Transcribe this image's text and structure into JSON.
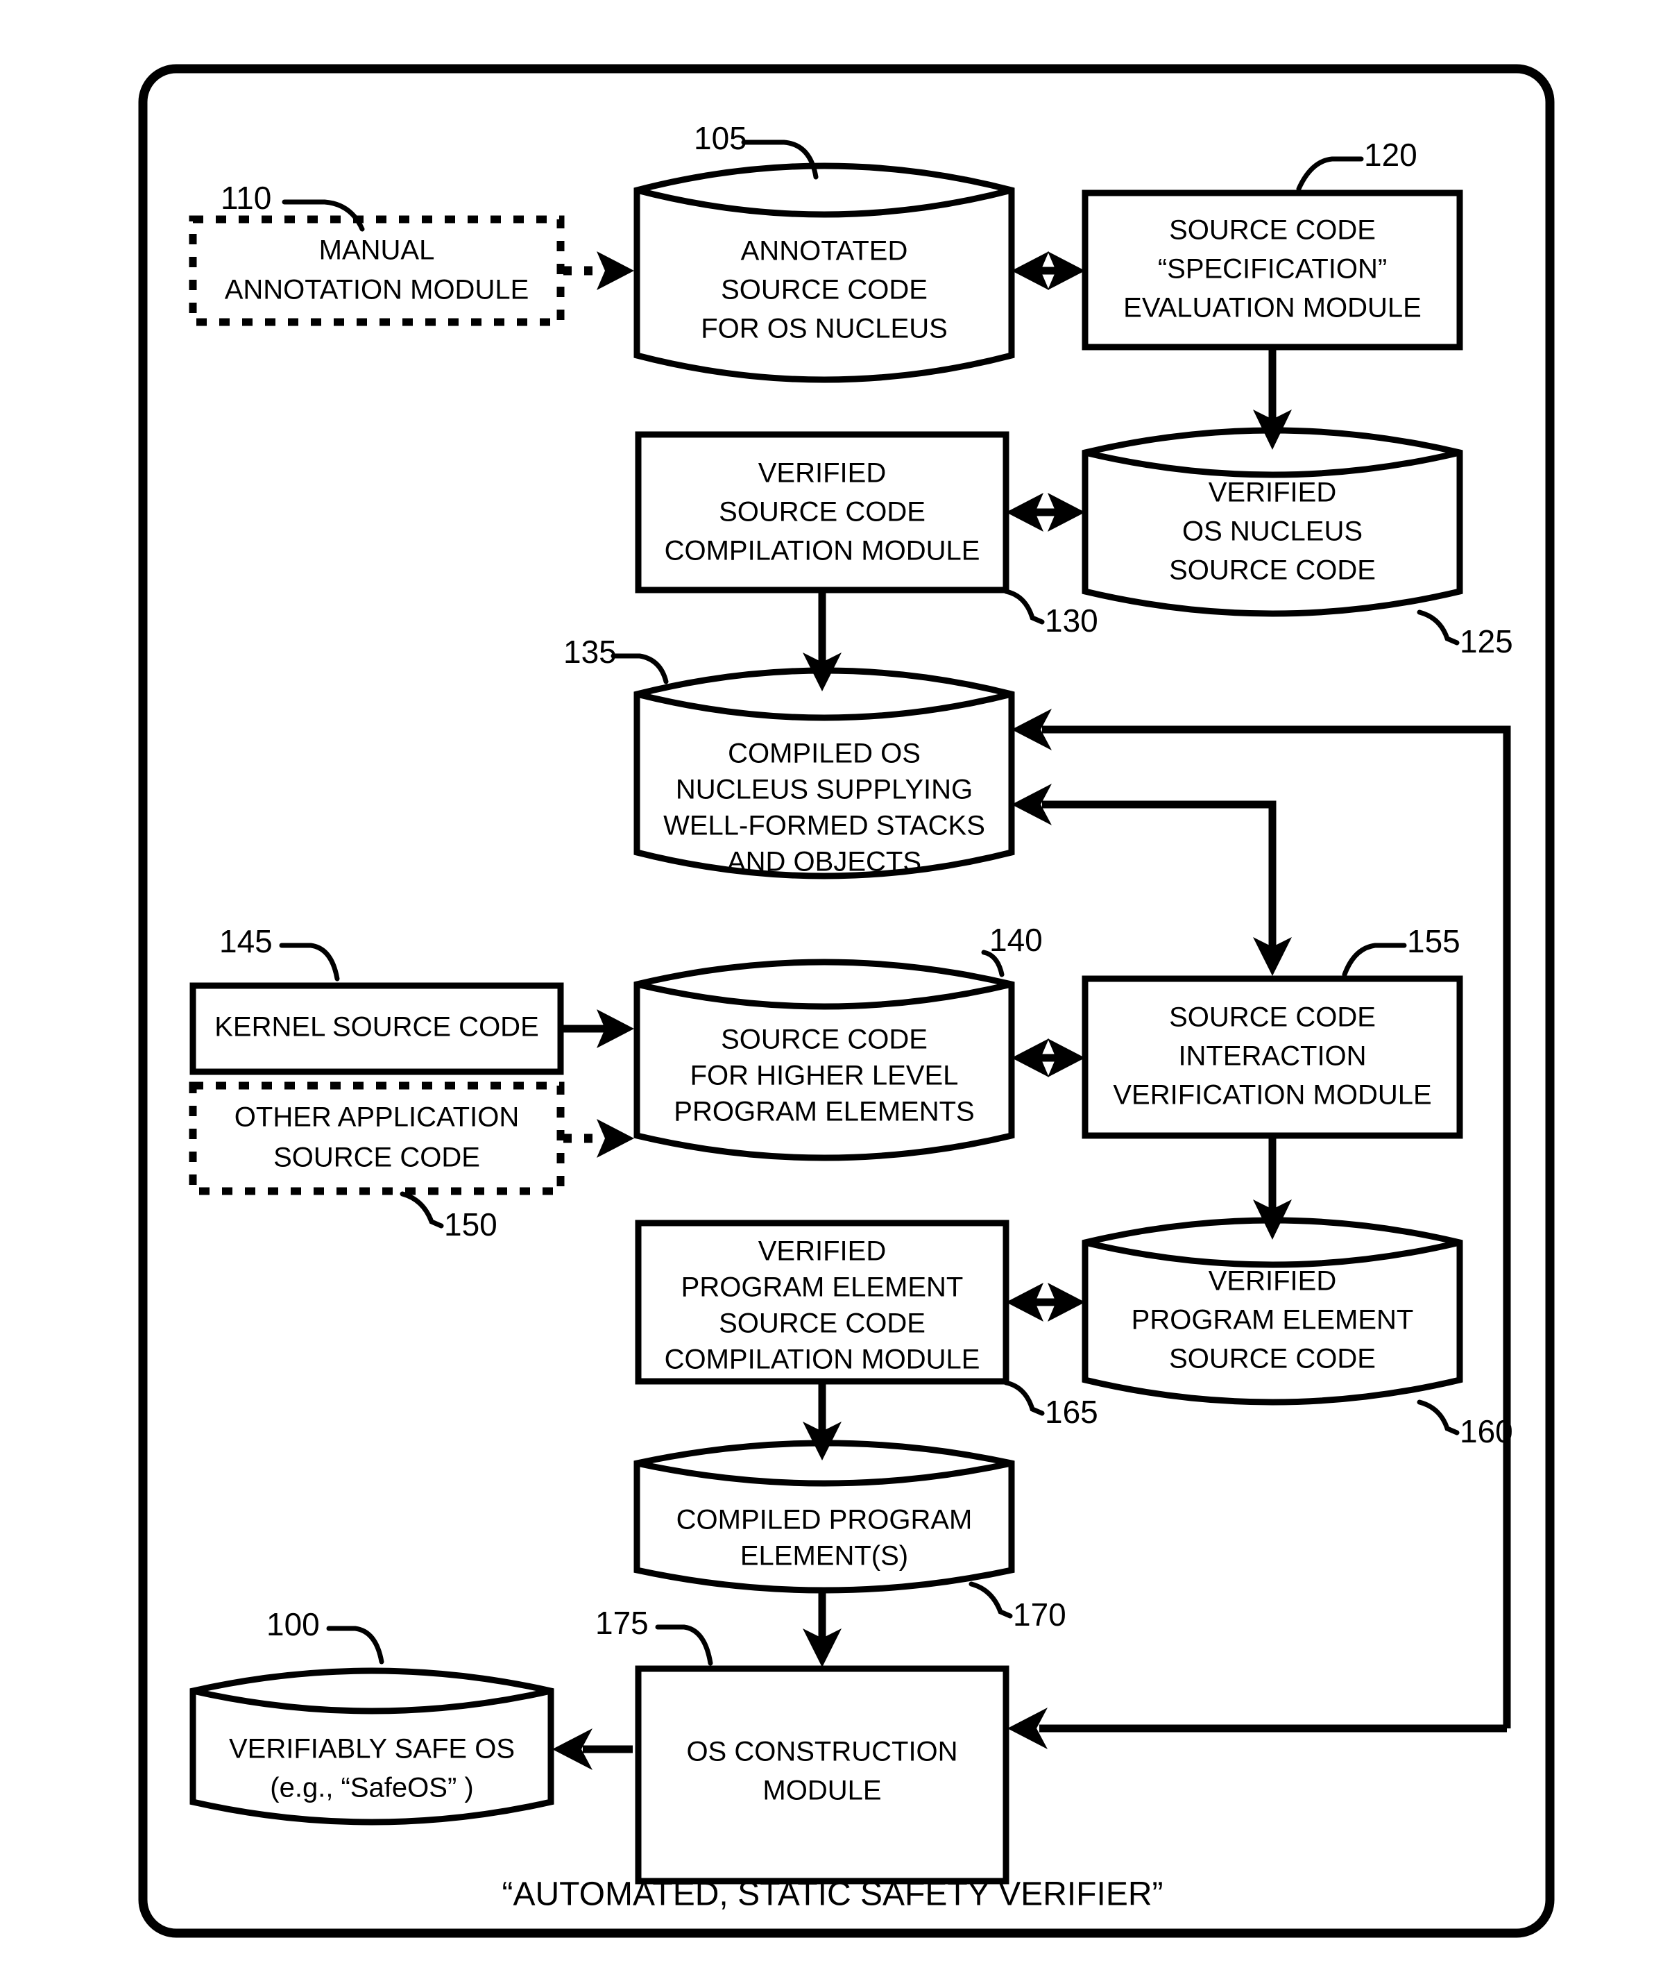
{
  "figure": {
    "caption": "“AUTOMATED, STATIC SAFETY VERIFIER”"
  },
  "nodes": {
    "manual_annotation_module": {
      "ref": "110",
      "lines": [
        "MANUAL",
        "ANNOTATION MODULE"
      ],
      "shape": "dashed-box"
    },
    "annotated_source_code": {
      "ref": "105",
      "lines": [
        "ANNOTATED",
        "SOURCE CODE",
        "FOR OS NUCLEUS"
      ],
      "shape": "cylinder"
    },
    "spec_evaluation_module": {
      "ref": "120",
      "lines": [
        "SOURCE CODE",
        "“SPECIFICATION”",
        "EVALUATION MODULE"
      ],
      "shape": "box"
    },
    "verified_source_code_compilation_module": {
      "ref": "130",
      "lines": [
        "VERIFIED",
        "SOURCE CODE",
        "COMPILATION MODULE"
      ],
      "shape": "box"
    },
    "verified_os_nucleus_source_code": {
      "ref": "125",
      "lines": [
        "VERIFIED",
        "OS NUCLEUS",
        "SOURCE CODE"
      ],
      "shape": "cylinder"
    },
    "compiled_os_nucleus": {
      "ref": "135",
      "lines": [
        "COMPILED OS",
        "NUCLEUS SUPPLYING",
        "WELL-FORMED STACKS",
        "AND OBJECTS"
      ],
      "shape": "cylinder"
    },
    "kernel_source_code": {
      "ref": "145",
      "lines": [
        "KERNEL SOURCE CODE"
      ],
      "shape": "box"
    },
    "other_application_source_code": {
      "ref": "150",
      "lines": [
        "OTHER APPLICATION",
        "SOURCE CODE"
      ],
      "shape": "dashed-box"
    },
    "source_code_higher_level": {
      "ref": "140",
      "lines": [
        "SOURCE CODE",
        "FOR HIGHER LEVEL",
        "PROGRAM ELEMENTS"
      ],
      "shape": "cylinder"
    },
    "source_code_interaction_verification_module": {
      "ref": "155",
      "lines": [
        "SOURCE CODE",
        "INTERACTION",
        "VERIFICATION MODULE"
      ],
      "shape": "box"
    },
    "verified_program_element_compilation_module": {
      "ref": "165",
      "lines": [
        "VERIFIED",
        "PROGRAM ELEMENT",
        "SOURCE CODE",
        "COMPILATION MODULE"
      ],
      "shape": "box"
    },
    "verified_program_element_source_code": {
      "ref": "160",
      "lines": [
        "VERIFIED",
        "PROGRAM ELEMENT",
        "SOURCE CODE"
      ],
      "shape": "cylinder"
    },
    "compiled_program_elements": {
      "ref": "170",
      "lines": [
        "COMPILED PROGRAM",
        "ELEMENT(S)"
      ],
      "shape": "cylinder"
    },
    "os_construction_module": {
      "ref": "175",
      "lines": [
        "OS CONSTRUCTION",
        "MODULE"
      ],
      "shape": "box"
    },
    "verifiably_safe_os": {
      "ref": "100",
      "lines": [
        "VERIFIABLY SAFE OS",
        "(e.g., “SafeOS” )"
      ],
      "shape": "cylinder"
    }
  },
  "colors": {
    "stroke": "#000000",
    "fill": "#ffffff",
    "background": "#ffffff"
  }
}
